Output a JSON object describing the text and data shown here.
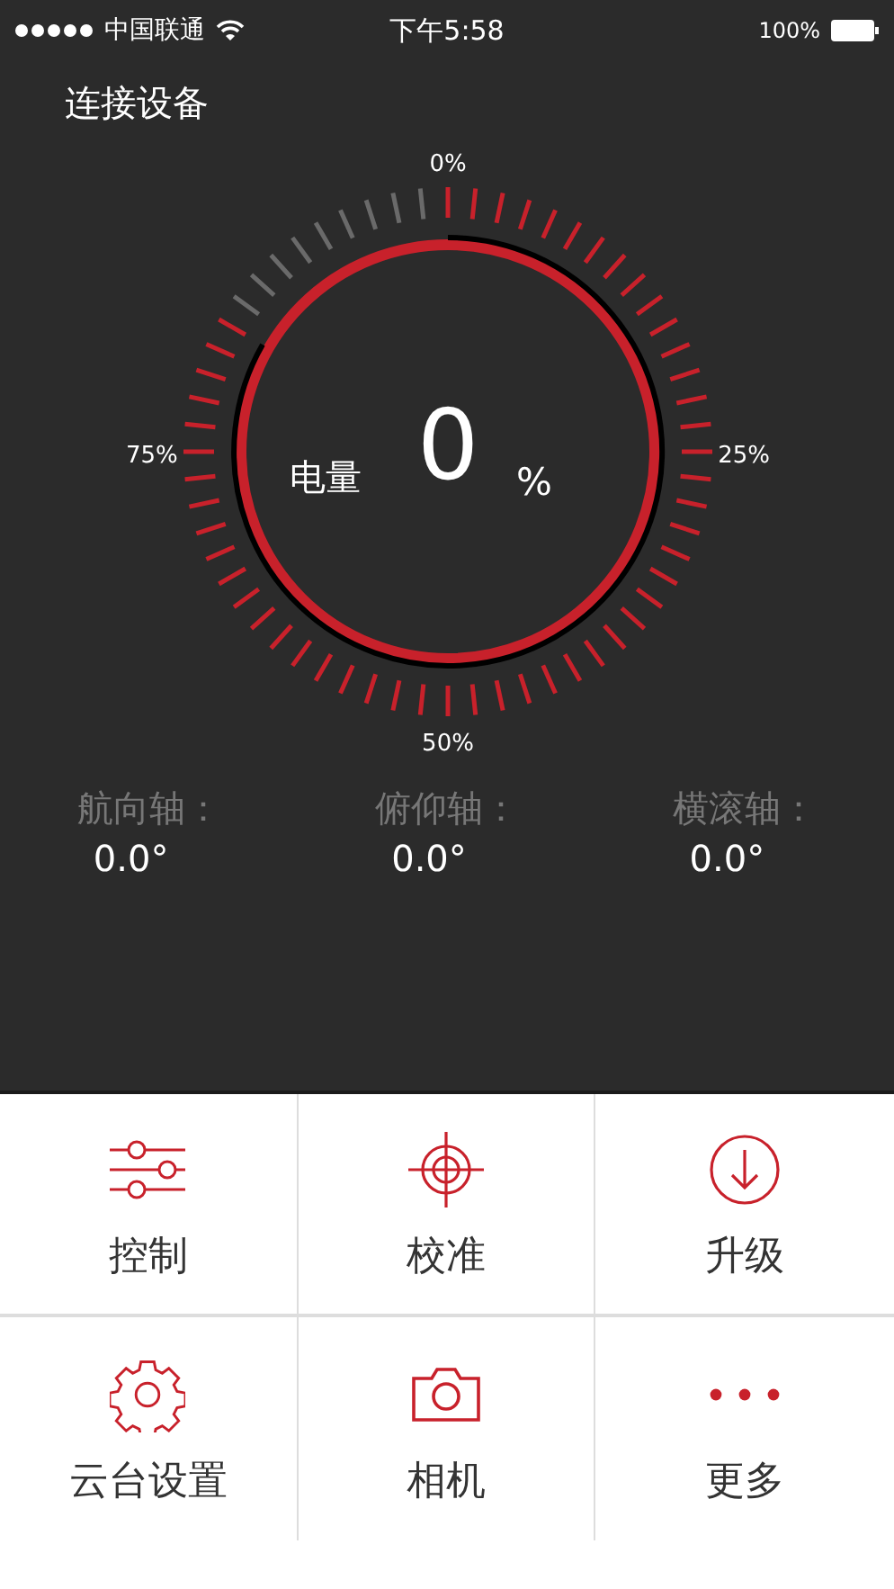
{
  "status_bar": {
    "carrier": "中国联通",
    "time": "下午5:58",
    "battery": "100%"
  },
  "header": {
    "title": "连接设备"
  },
  "gauge": {
    "labels": [
      "0%",
      "25%",
      "50%",
      "75%"
    ],
    "caption": "电量",
    "value": "0",
    "unit": "%"
  },
  "axes": [
    {
      "label": "航向轴：",
      "value": "0.0°"
    },
    {
      "label": "俯仰轴：",
      "value": "0.0°"
    },
    {
      "label": "横滚轴：",
      "value": "0.0°"
    }
  ],
  "menu": [
    {
      "label": "控制"
    },
    {
      "label": "校准"
    },
    {
      "label": "升级"
    },
    {
      "label": "云台设置"
    },
    {
      "label": "相机"
    },
    {
      "label": "更多"
    }
  ]
}
